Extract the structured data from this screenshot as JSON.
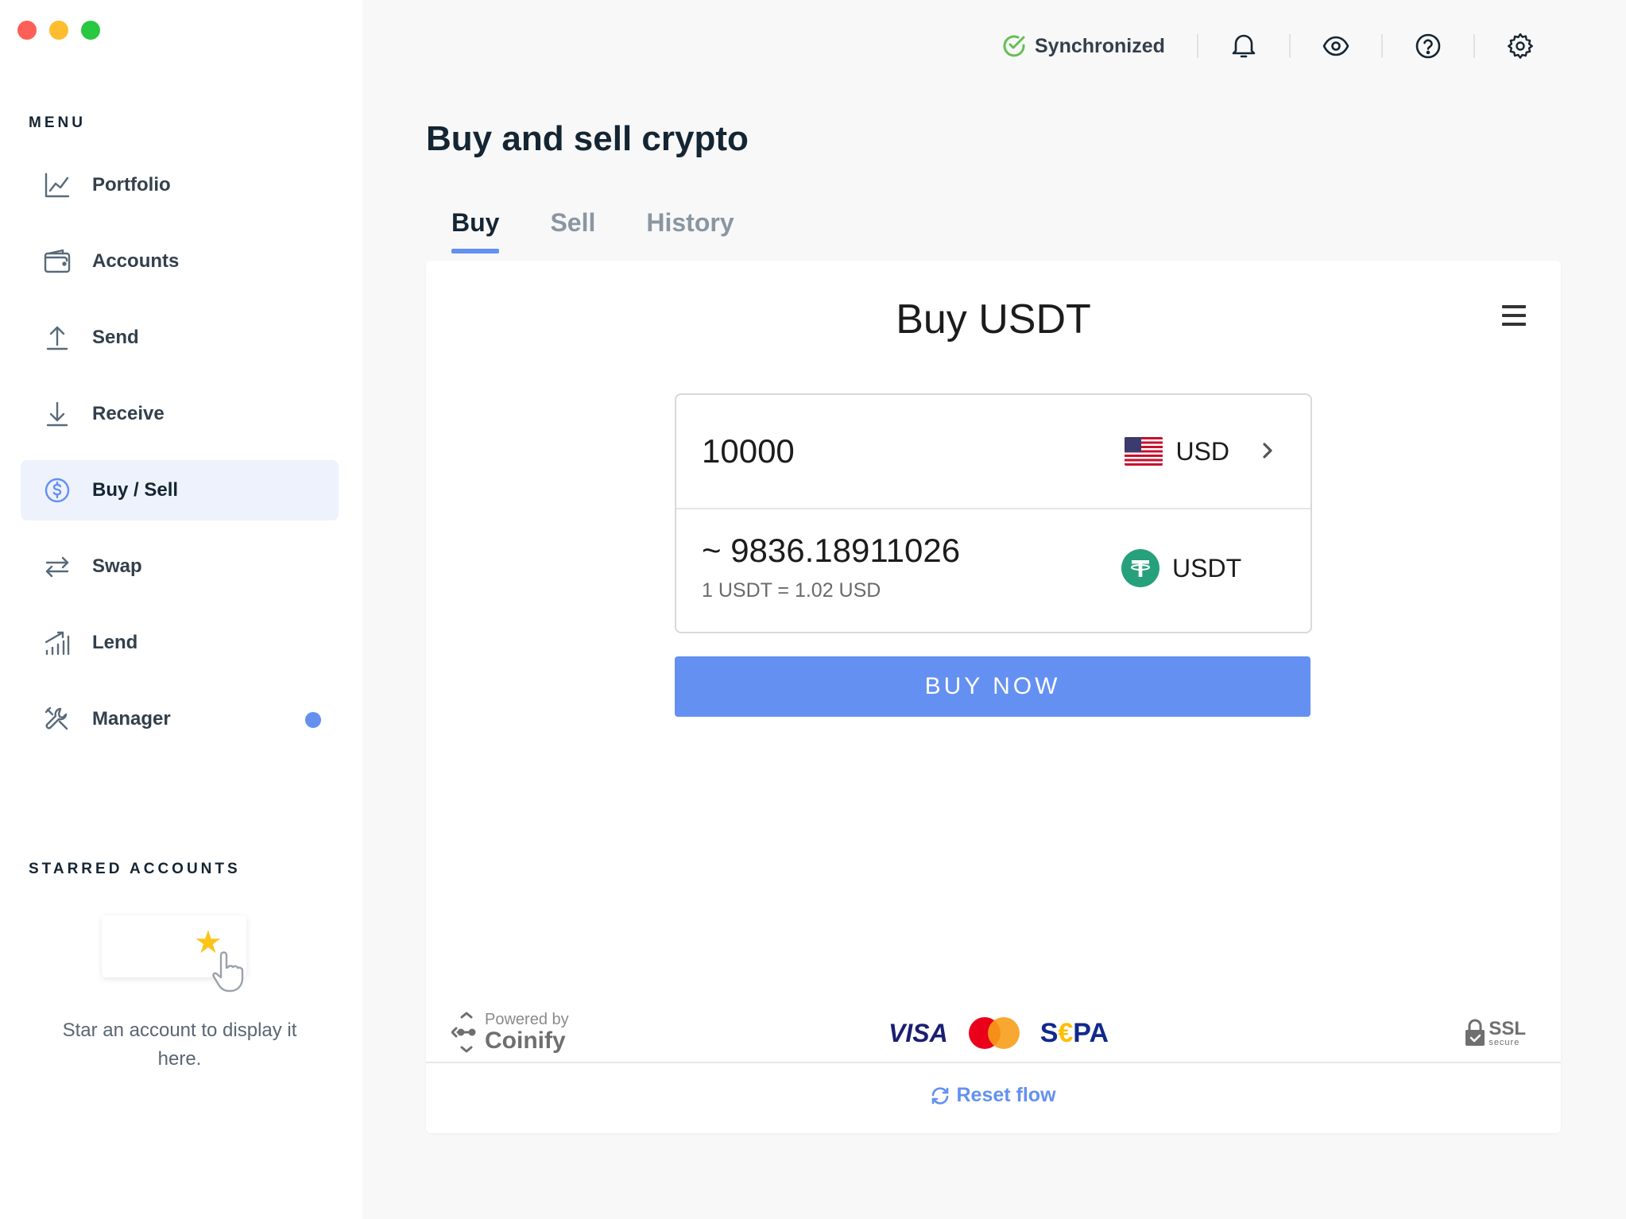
{
  "window": {
    "controls": [
      "close",
      "minimize",
      "zoom"
    ]
  },
  "sidebar": {
    "menu_label": "MENU",
    "items": [
      {
        "label": "Portfolio",
        "icon": "chart-line-icon",
        "active": false
      },
      {
        "label": "Accounts",
        "icon": "wallet-icon",
        "active": false
      },
      {
        "label": "Send",
        "icon": "arrow-up-icon",
        "active": false
      },
      {
        "label": "Receive",
        "icon": "arrow-down-icon",
        "active": false
      },
      {
        "label": "Buy / Sell",
        "icon": "dollar-circle-icon",
        "active": true
      },
      {
        "label": "Swap",
        "icon": "swap-arrows-icon",
        "active": false
      },
      {
        "label": "Lend",
        "icon": "bars-growth-icon",
        "active": false
      },
      {
        "label": "Manager",
        "icon": "tools-icon",
        "active": false,
        "badge": true
      }
    ],
    "starred_label": "STARRED ACCOUNTS",
    "starred_empty_text": "Star an account to display it here."
  },
  "topbar": {
    "sync_status": "Synchronized",
    "icons": [
      "bell-icon",
      "eye-icon",
      "help-icon",
      "settings-icon"
    ]
  },
  "main": {
    "title": "Buy and sell crypto",
    "tabs": [
      {
        "label": "Buy",
        "active": true
      },
      {
        "label": "Sell",
        "active": false
      },
      {
        "label": "History",
        "active": false
      }
    ],
    "widget": {
      "title": "Buy USDT",
      "pay_amount": "10000",
      "pay_currency": "USD",
      "receive_amount": "~ 9836.18911026",
      "rate": "1 USDT = 1.02 USD",
      "receive_currency": "USDT",
      "buy_button": "BUY NOW",
      "powered_by_small": "Powered by",
      "powered_by_brand": "Coinify",
      "payment_methods": [
        "VISA",
        "Mastercard",
        "SEPA"
      ],
      "sepa_parts": [
        "S",
        "€",
        "PA"
      ],
      "ssl_big": "SSL",
      "ssl_small": "secure",
      "reset_label": "Reset flow"
    }
  },
  "colors": {
    "accent": "#6490f1",
    "sync_green": "#66be54",
    "tether_green": "#26a17b"
  }
}
